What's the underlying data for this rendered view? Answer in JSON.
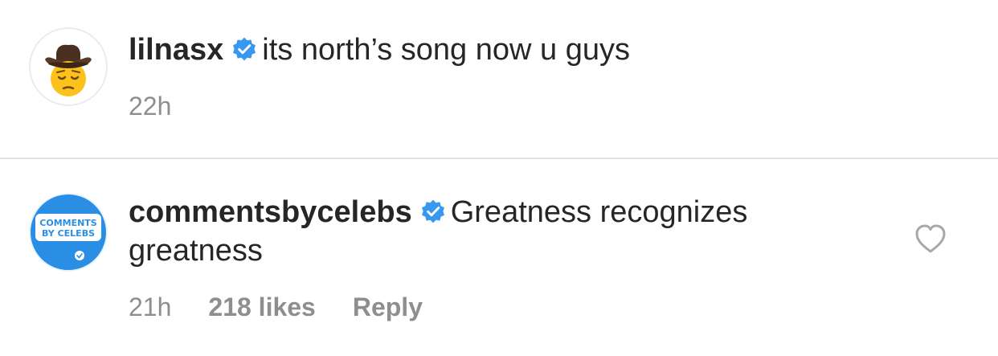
{
  "comments": [
    {
      "username": "lilnasx",
      "text": "its north’s song now u guys",
      "timestamp": "22h",
      "avatar_icon": "pensive-cowboy-emoji-icon",
      "verified": true
    },
    {
      "username": "commentsbycelebs",
      "text": "Greatness recognizes greatness",
      "timestamp": "21h",
      "likes": "218 likes",
      "reply_label": "Reply",
      "avatar_icon": "comments-by-celebs-logo",
      "avatar_text_line1": "COMMENTS",
      "avatar_text_line2": "BY CELEBS",
      "verified": true
    }
  ],
  "colors": {
    "verified_badge": "#3897f0",
    "meta_gray": "#8e8e8e",
    "text": "#262626",
    "avatar_blue": "#2a8fe4"
  }
}
